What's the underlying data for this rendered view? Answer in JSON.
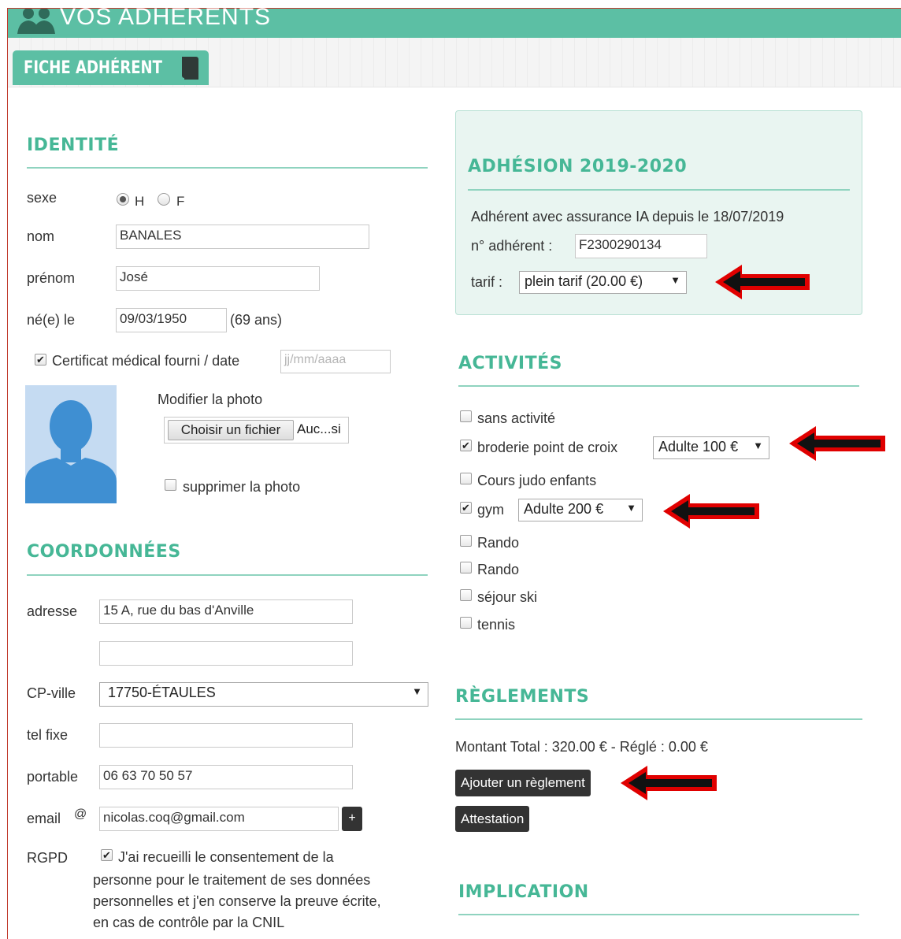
{
  "header": {
    "title": "VOS ADHERENTS",
    "icon": "users-icon"
  },
  "tab": {
    "label": "FICHE ADHÉRENT",
    "icon": "book-icon"
  },
  "identite": {
    "heading": "IDENTITÉ",
    "sexe_label": "sexe",
    "sexe_options": [
      "H",
      "F"
    ],
    "sexe_selected": "H",
    "nom_label": "nom",
    "nom_value": "BANALES",
    "prenom_label": "prénom",
    "prenom_value": "José",
    "ne_label": "né(e) le",
    "ne_value": "09/03/1950",
    "age": "(69 ans)",
    "certificat_label": "Certificat médical fourni / date",
    "certificat_checked": true,
    "certificat_placeholder": "jj/mm/aaaa",
    "photo_label": "Modifier la photo",
    "file_button": "Choisir un fichier",
    "file_status": "Auc...si",
    "supprimer_label": "supprimer la photo"
  },
  "coordonnees": {
    "heading": "COORDONNÉES",
    "adresse_label": "adresse",
    "adresse_value": "15 A, rue du bas d'Anville",
    "adresse2_value": "",
    "cp_label": "CP-ville",
    "cp_value": "17750-ÉTAULES",
    "tel_label": "tel fixe",
    "tel_value": "",
    "portable_label": "portable",
    "portable_value": "06 63 70 50 57",
    "email_label": "email",
    "email_at": "@",
    "email_value": "nicolas.coq@gmail.com",
    "email_add": "+",
    "rgpd_label": "RGPD",
    "rgpd_checked": true,
    "rgpd_lines": [
      "J'ai recueilli le consentement de la",
      "personne pour le traitement de ses données",
      "personnelles et j'en conserve la preuve écrite,",
      "en cas de contrôle par la CNIL"
    ]
  },
  "adhesion": {
    "heading": "ADHÉSION 2019-2020",
    "info": "Adhérent avec assurance IA depuis le 18/07/2019",
    "numero_label": "n° adhérent :",
    "numero_value": "F2300290134",
    "tarif_label": "tarif :",
    "tarif_value": "plein tarif (20.00 €)"
  },
  "activites": {
    "heading": "ACTIVITÉS",
    "items": [
      {
        "label": "sans activité",
        "checked": false,
        "tarif": ""
      },
      {
        "label": "broderie point de croix",
        "checked": true,
        "tarif": "Adulte 100 €"
      },
      {
        "label": "Cours judo enfants",
        "checked": false,
        "tarif": ""
      },
      {
        "label": "gym",
        "checked": true,
        "tarif": "Adulte 200 €"
      },
      {
        "label": "Rando",
        "checked": false,
        "tarif": ""
      },
      {
        "label": "Rando",
        "checked": false,
        "tarif": ""
      },
      {
        "label": "séjour ski",
        "checked": false,
        "tarif": ""
      },
      {
        "label": "tennis",
        "checked": false,
        "tarif": ""
      }
    ]
  },
  "reglements": {
    "heading": "RÈGLEMENTS",
    "total": "Montant Total : 320.00 € - Réglé : 0.00 €",
    "add_button": "Ajouter un règlement",
    "attestation_button": "Attestation"
  },
  "implication": {
    "heading": "IMPLICATION"
  },
  "colors": {
    "accent": "#5cbfa4",
    "heading": "#46b796",
    "arrow": "#e00000"
  }
}
